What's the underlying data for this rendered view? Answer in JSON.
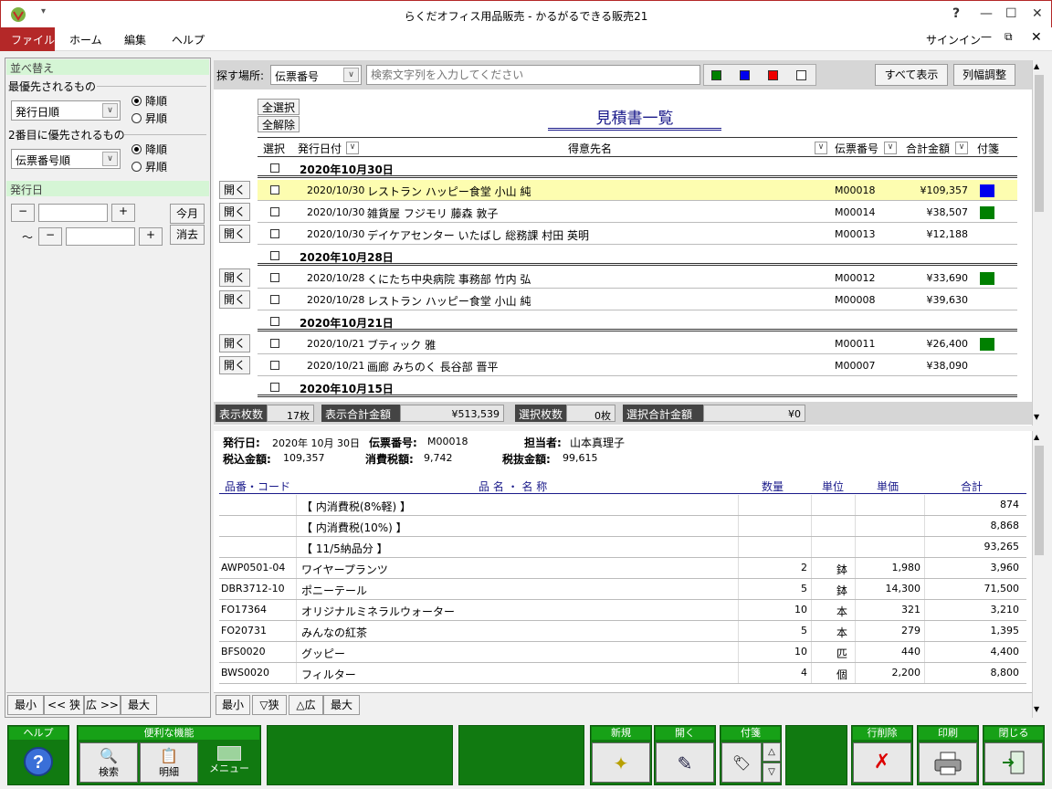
{
  "app": {
    "title": "らくだオフィス用品販売 - かるがるできる販売21",
    "help_q": "?",
    "signin": "サインイン"
  },
  "menu": [
    "ファイル",
    "ホーム",
    "編集",
    "ヘルプ"
  ],
  "sort": {
    "header": "並べ替え",
    "primary_label": "最優先されるもの",
    "primary_value": "発行日順",
    "secondary_label": "2番目に優先されるもの",
    "secondary_value": "伝票番号順",
    "desc": "降順",
    "asc": "昇順"
  },
  "date_filter": {
    "header": "発行日",
    "minus": "−",
    "plus": "+",
    "this_month": "今月",
    "clear": "消去",
    "tilde": "〜"
  },
  "left_footer": [
    "最小",
    "<< 狭",
    "広 >>",
    "最大"
  ],
  "search": {
    "label": "探す場所:",
    "field": "伝票番号",
    "placeholder": "検索文字列を入力してください",
    "show_all": "すべて表示",
    "col_adjust": "列幅調整",
    "colors": [
      "#008000",
      "#0000ee",
      "#ee0000",
      "#ffffff"
    ]
  },
  "list": {
    "title": "見積書一覧",
    "select_all": "全選択",
    "deselect_all": "全解除",
    "open": "開く",
    "columns": [
      "選択",
      "発行日付",
      "得意先名",
      "伝票番号",
      "合計金額",
      "付箋"
    ],
    "groups": [
      {
        "date": "2020年10月30日",
        "rows": [
          {
            "date": "2020/10/30",
            "customer": "レストラン ハッピー食堂 小山 純",
            "no": "M00018",
            "total": "¥109,357",
            "tag": "#0000ee",
            "selected": true
          },
          {
            "date": "2020/10/30",
            "customer": "雑貨屋 フジモリ 藤森 敦子",
            "no": "M00014",
            "total": "¥38,507",
            "tag": "#008000"
          },
          {
            "date": "2020/10/30",
            "customer": "デイケアセンター いたばし 総務課 村田 英明",
            "no": "M00013",
            "total": "¥12,188",
            "tag": ""
          }
        ]
      },
      {
        "date": "2020年10月28日",
        "rows": [
          {
            "date": "2020/10/28",
            "customer": "くにたち中央病院 事務部 竹内 弘",
            "no": "M00012",
            "total": "¥33,690",
            "tag": "#008000"
          },
          {
            "date": "2020/10/28",
            "customer": "レストラン ハッピー食堂 小山 純",
            "no": "M00008",
            "total": "¥39,630",
            "tag": ""
          }
        ]
      },
      {
        "date": "2020年10月21日",
        "rows": [
          {
            "date": "2020/10/21",
            "customer": "ブティック 雅",
            "no": "M00011",
            "total": "¥26,400",
            "tag": "#008000"
          },
          {
            "date": "2020/10/21",
            "customer": "画廊 みちのく 長谷部 晋平",
            "no": "M00007",
            "total": "¥38,090",
            "tag": ""
          }
        ]
      },
      {
        "date": "2020年10月15日",
        "rows": []
      }
    ]
  },
  "summary": {
    "count_label": "表示枚数",
    "count": "17枚",
    "total_label": "表示合計金額",
    "total": "¥513,539",
    "sel_count_label": "選択枚数",
    "sel_count": "0枚",
    "sel_total_label": "選択合計金額",
    "sel_total": "¥0"
  },
  "detail": {
    "date_label": "発行日:",
    "date": "2020年 10月 30日",
    "no_label": "伝票番号:",
    "no": "M00018",
    "staff_label": "担当者:",
    "staff": "山本真理子",
    "taxin_label": "税込金額:",
    "taxin": "109,357",
    "tax_label": "消費税額:",
    "tax": "9,742",
    "taxout_label": "税抜金額:",
    "taxout": "99,615",
    "columns": [
      "品番・コード",
      "品 名 ・ 名 称",
      "数量",
      "単位",
      "単価",
      "合計"
    ],
    "rows": [
      {
        "code": "",
        "name": "【 内消費税(8%軽) 】",
        "qty": "",
        "unit": "",
        "price": "",
        "total": "874"
      },
      {
        "code": "",
        "name": "【 内消費税(10%) 】",
        "qty": "",
        "unit": "",
        "price": "",
        "total": "8,868"
      },
      {
        "code": "",
        "name": "【 11/5納品分 】",
        "qty": "",
        "unit": "",
        "price": "",
        "total": "93,265"
      },
      {
        "code": "AWP0501-04",
        "name": "ワイヤープランツ",
        "qty": "2",
        "unit": "鉢",
        "price": "1,980",
        "total": "3,960"
      },
      {
        "code": "DBR3712-10",
        "name": "ポニーテール",
        "qty": "5",
        "unit": "鉢",
        "price": "14,300",
        "total": "71,500"
      },
      {
        "code": "FO17364",
        "name": "オリジナルミネラルウォーター",
        "qty": "10",
        "unit": "本",
        "price": "321",
        "total": "3,210"
      },
      {
        "code": "FO20731",
        "name": "みんなの紅茶",
        "qty": "5",
        "unit": "本",
        "price": "279",
        "total": "1,395"
      },
      {
        "code": "BFS0020",
        "name": "グッピー",
        "qty": "10",
        "unit": "匹",
        "price": "440",
        "total": "4,400"
      },
      {
        "code": "BWS0020",
        "name": "フィルター",
        "qty": "4",
        "unit": "個",
        "price": "2,200",
        "total": "8,800"
      }
    ]
  },
  "detail_footer": [
    "最小",
    "▽狭",
    "△広",
    "最大"
  ],
  "bottom": {
    "help": "ヘルプ",
    "tools": "便利な機能",
    "search": "検索",
    "detail": "明細",
    "menu": "メニュー",
    "new": "新規",
    "open": "開く",
    "tag": "付箋",
    "delrow": "行削除",
    "print": "印刷",
    "close": "閉じる"
  }
}
